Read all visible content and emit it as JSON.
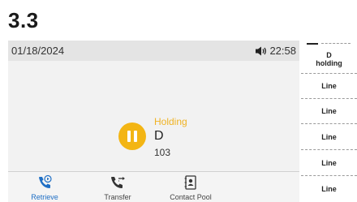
{
  "section_heading": "3.3",
  "status_bar": {
    "date": "01/18/2024",
    "time": "22:58",
    "speaker_icon": "speaker-volume-icon"
  },
  "call": {
    "status": "Holding",
    "name": "D",
    "number": "103",
    "status_icon": "pause-icon",
    "accent_color": "#f3b514"
  },
  "softkeys": [
    {
      "label": "Retrieve",
      "icon": "retrieve-call-icon",
      "active": true
    },
    {
      "label": "Transfer",
      "icon": "transfer-call-icon",
      "active": false
    },
    {
      "label": "Contact Pool",
      "icon": "contact-book-icon",
      "active": false
    }
  ],
  "line_keys": [
    {
      "line1": "D",
      "line2": "holding"
    },
    {
      "line1": "Line",
      "line2": ""
    },
    {
      "line1": "Line",
      "line2": ""
    },
    {
      "line1": "Line",
      "line2": ""
    },
    {
      "line1": "Line",
      "line2": ""
    },
    {
      "line1": "Line",
      "line2": ""
    }
  ]
}
